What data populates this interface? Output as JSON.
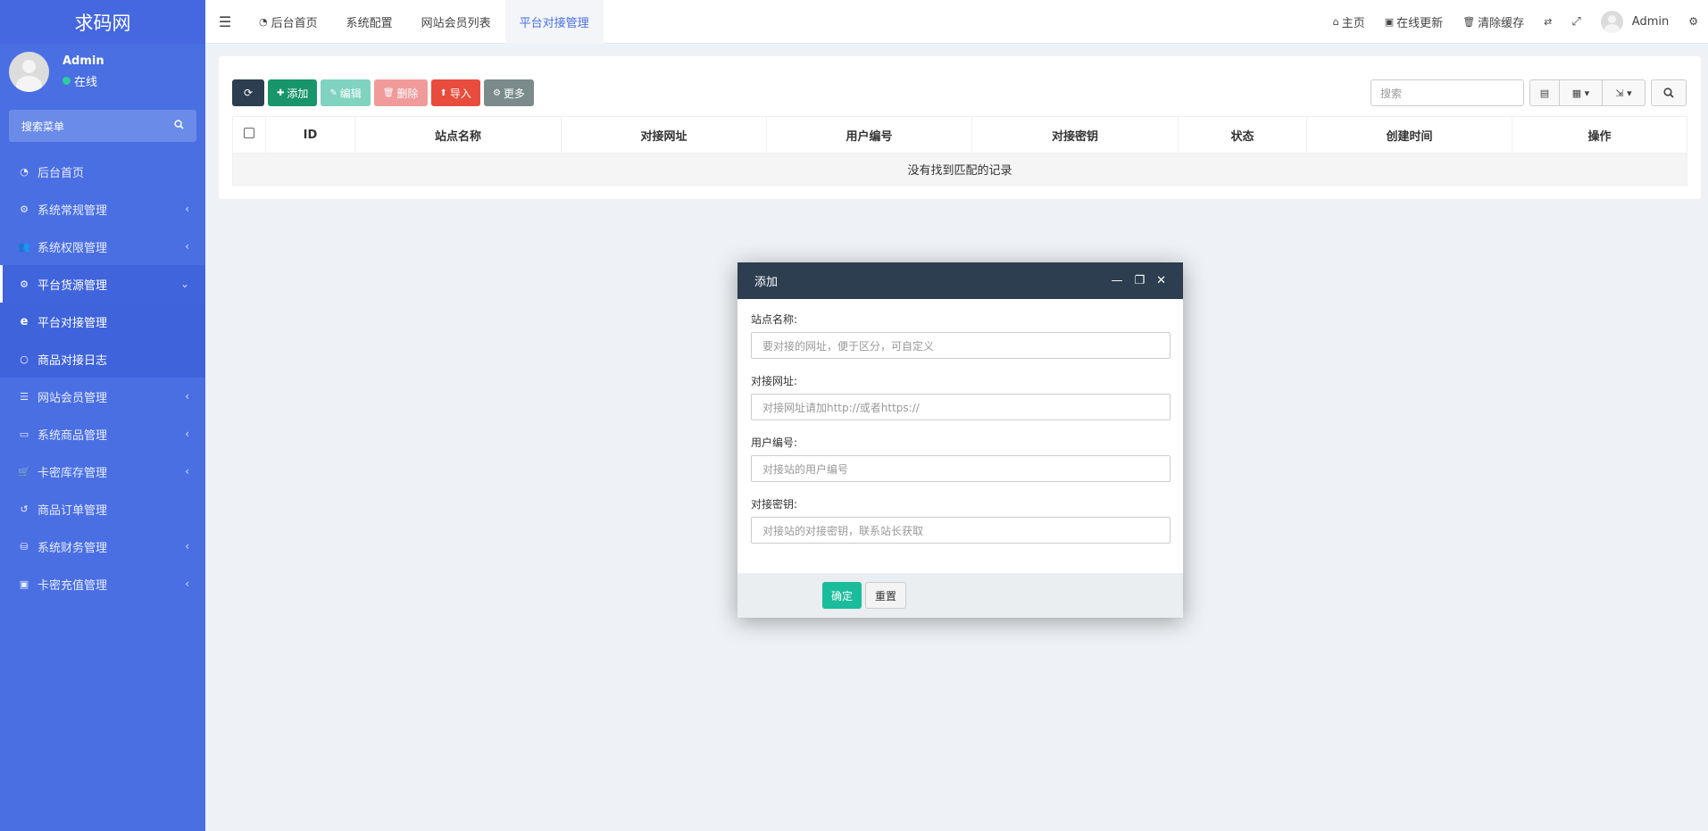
{
  "sidebar": {
    "logo": "求码网",
    "user_name": "Admin",
    "user_status": "在线",
    "search_label": "搜索菜单",
    "items": [
      {
        "label": "后台首页",
        "icon": "dashboard-icon",
        "glyph": "◔",
        "arrow": ""
      },
      {
        "label": "系统常规管理",
        "icon": "cogs-icon",
        "glyph": "⚙",
        "arrow": "‹"
      },
      {
        "label": "系统权限管理",
        "icon": "users-icon",
        "glyph": "👥",
        "arrow": "‹"
      },
      {
        "label": "平台货源管理",
        "icon": "cogs-icon",
        "glyph": "⚙",
        "arrow": "⌄"
      }
    ],
    "sub_items": [
      {
        "label": "平台对接管理",
        "icon": "ie-icon",
        "glyph": "e"
      },
      {
        "label": "商品对接日志",
        "icon": "circle-icon",
        "glyph": "○"
      }
    ],
    "items_after": [
      {
        "label": "网站会员管理",
        "icon": "list-icon",
        "glyph": "☰",
        "arrow": "‹"
      },
      {
        "label": "系统商品管理",
        "icon": "id-card-icon",
        "glyph": "▭",
        "arrow": "‹"
      },
      {
        "label": "卡密库存管理",
        "icon": "cart-icon",
        "glyph": "🛒",
        "arrow": "‹"
      },
      {
        "label": "商品订单管理",
        "icon": "history-icon",
        "glyph": "↺",
        "arrow": ""
      },
      {
        "label": "系统财务管理",
        "icon": "binoculars-icon",
        "glyph": "⛁",
        "arrow": "‹"
      },
      {
        "label": "卡密充值管理",
        "icon": "money-icon",
        "glyph": "▣",
        "arrow": "‹"
      }
    ]
  },
  "topbar": {
    "tabs": [
      "后台首页",
      "系统配置",
      "网站会员列表",
      "平台对接管理"
    ],
    "right": {
      "home": "主页",
      "update": "在线更新",
      "clear_cache": "清除缓存",
      "admin": "Admin"
    }
  },
  "toolbar": {
    "add": "添加",
    "edit": "编辑",
    "delete": "删除",
    "import": "导入",
    "more": "更多",
    "search_placeholder": "搜索"
  },
  "table": {
    "columns": [
      "ID",
      "站点名称",
      "对接网址",
      "用户编号",
      "对接密钥",
      "状态",
      "创建时间",
      "操作"
    ],
    "empty_text": "没有找到匹配的记录"
  },
  "modal": {
    "title": "添加",
    "fields": [
      {
        "label": "站点名称:",
        "placeholder": "要对接的网址，便于区分，可自定义"
      },
      {
        "label": "对接网址:",
        "placeholder": "对接网址请加http://或者https://"
      },
      {
        "label": "用户编号:",
        "placeholder": "对接站的用户编号"
      },
      {
        "label": "对接密钥:",
        "placeholder": "对接站的对接密钥，联系站长获取"
      }
    ],
    "ok": "确定",
    "reset": "重置"
  },
  "colors": {
    "sidebar": "#4a6fe3",
    "modal_header": "#2c3e50",
    "ok_button": "#1abc9c"
  }
}
